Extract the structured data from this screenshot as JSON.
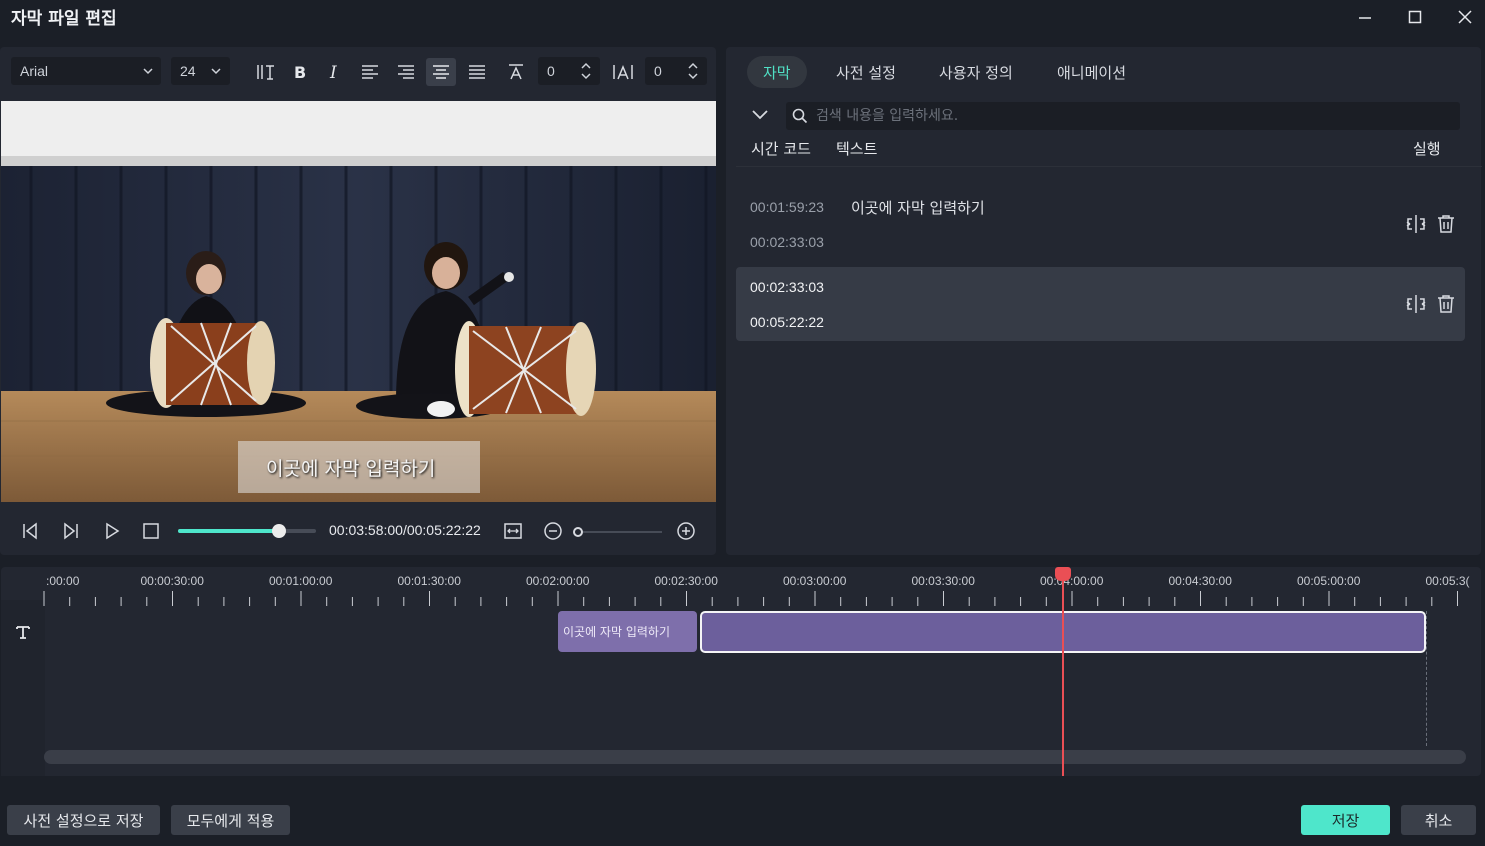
{
  "window": {
    "title": "자막 파일 편집",
    "controls": [
      "minimize-icon",
      "maximize-icon",
      "close-icon"
    ]
  },
  "toolbar": {
    "font": "Arial",
    "font_size": "24",
    "char_spacing": "0",
    "line_spacing": "0",
    "active_align": "align-center"
  },
  "preview": {
    "subtitle_overlay": "이곳에 자막 입력하기",
    "timecode": "00:03:58:00/00:05:22:22",
    "progress": 0.73
  },
  "tabs": [
    {
      "label": "자막",
      "active": true
    },
    {
      "label": "사전 설정",
      "active": false
    },
    {
      "label": "사용자 정의",
      "active": false
    },
    {
      "label": "애니메이션",
      "active": false
    }
  ],
  "search": {
    "placeholder": "검색 내용을 입력하세요."
  },
  "list": {
    "col_time": "시간 코드",
    "col_text": "텍스트",
    "col_action": "실행",
    "rows": [
      {
        "start": "00:01:59:23",
        "end": "00:02:33:03",
        "text": "이곳에 자막 입력하기",
        "selected": false
      },
      {
        "start": "00:02:33:03",
        "end": "00:05:22:22",
        "text": "",
        "selected": true
      }
    ]
  },
  "timeline": {
    "ruler": [
      ":00:00",
      "00:00:30:00",
      "00:01:00:00",
      "00:01:30:00",
      "00:02:00:00",
      "00:02:30:00",
      "00:03:00:00",
      "00:03:30:00",
      "00:04:00:00",
      "00:04:30:00",
      "00:05:00:00",
      "00:05:3("
    ],
    "clip1_label": "이곳에 자막 입력하기",
    "playhead_color": "#ea4f55",
    "clip_color": "#6c5f9c"
  },
  "buttons": {
    "save_preset": "사전 설정으로 저장",
    "apply_all": "모두에게 적용",
    "save": "저장",
    "cancel": "취소"
  },
  "colors": {
    "accent": "#4ee6cb",
    "background": "#1b1f27",
    "panel": "#232731"
  }
}
